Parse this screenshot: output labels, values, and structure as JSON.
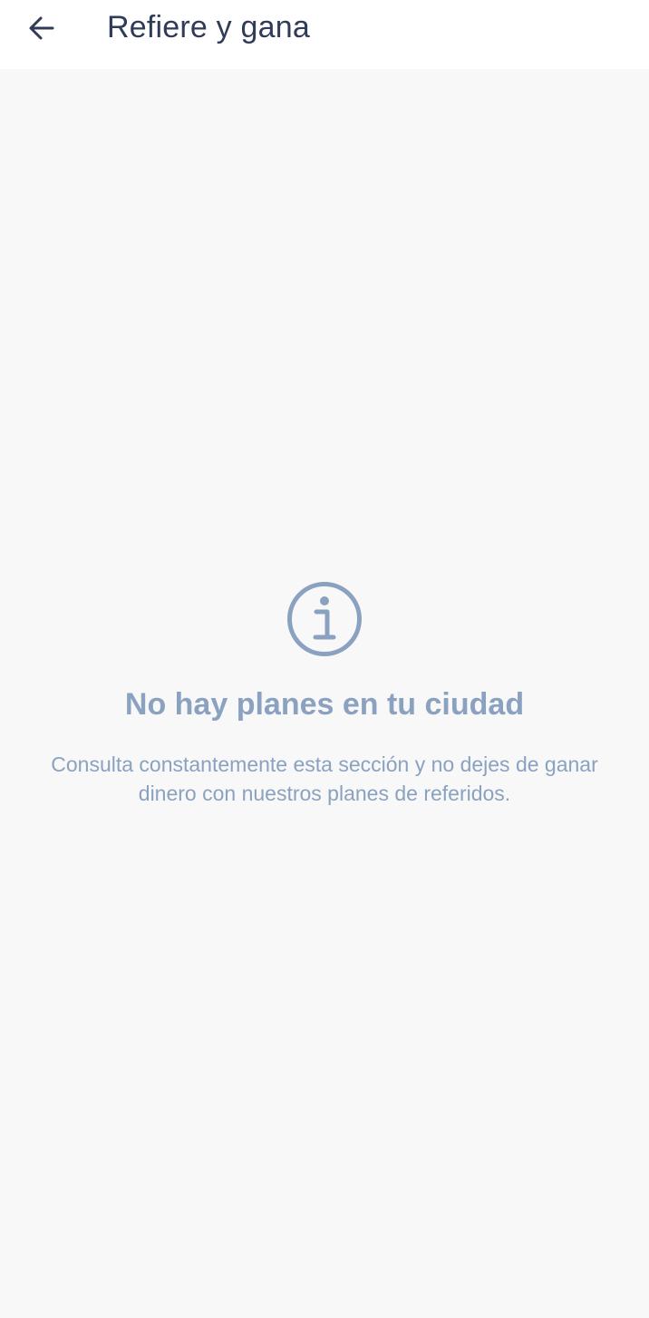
{
  "header": {
    "back_icon": "arrow-left-icon",
    "title": "Refiere y gana",
    "title_color": "#2f3b57"
  },
  "empty_state": {
    "icon": "info-icon",
    "title": "No hay planes en tu ciudad",
    "description": "Consulta constantemente esta sección y no dejes de ganar dinero con nuestros planes de referidos.",
    "accent_color": "#8aa2bf"
  }
}
